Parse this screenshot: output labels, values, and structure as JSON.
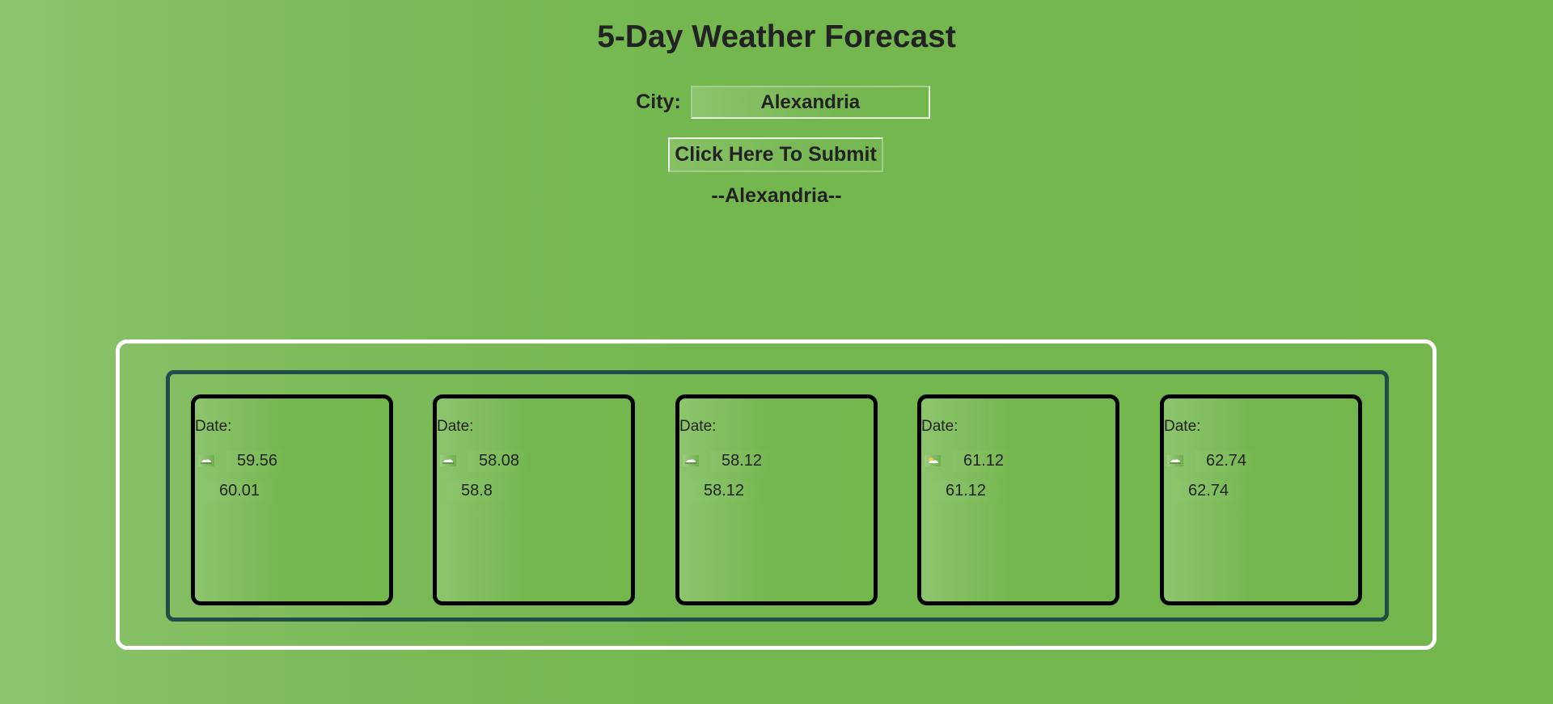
{
  "page": {
    "title": "5-Day Weather Forecast"
  },
  "form": {
    "city_label": "City:",
    "city_value": "Alexandria",
    "submit_label": "Click Here To Submit"
  },
  "result": {
    "city_heading": "--Alexandria--"
  },
  "forecast": [
    {
      "date_label": "Date:",
      "icon": "cloud-icon",
      "high": "59.56",
      "low": "60.01"
    },
    {
      "date_label": "Date:",
      "icon": "cloud-icon",
      "high": "58.08",
      "low": "58.8"
    },
    {
      "date_label": "Date:",
      "icon": "cloud-icon",
      "high": "58.12",
      "low": "58.12"
    },
    {
      "date_label": "Date:",
      "icon": "sun-cloud-icon",
      "high": "61.12",
      "low": "61.12"
    },
    {
      "date_label": "Date:",
      "icon": "cloud-icon",
      "high": "62.74",
      "low": "62.74"
    }
  ],
  "colors": {
    "background": "#74b74f",
    "outer_border": "#ffffff",
    "inner_border": "#1f4e4a",
    "card_border": "#000000"
  }
}
